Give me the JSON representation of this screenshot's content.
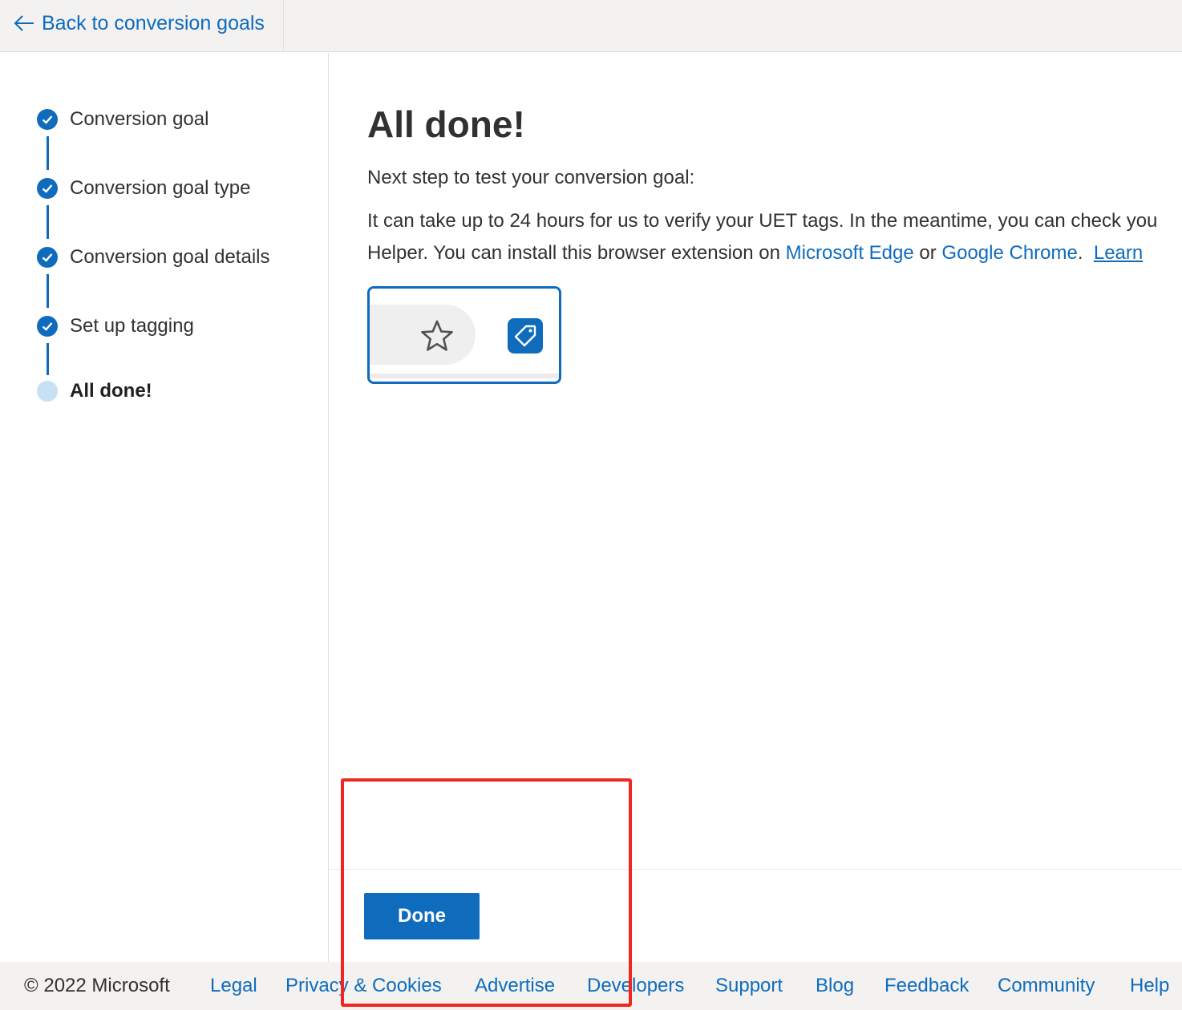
{
  "header": {
    "back_label": "Back to conversion goals"
  },
  "steps": [
    {
      "label": "Conversion goal",
      "state": "complete"
    },
    {
      "label": "Conversion goal type",
      "state": "complete"
    },
    {
      "label": "Conversion goal details",
      "state": "complete"
    },
    {
      "label": "Set up tagging",
      "state": "complete"
    },
    {
      "label": "All done!",
      "state": "current"
    }
  ],
  "main": {
    "title": "All done!",
    "subtitle": "Next step to test your conversion goal:",
    "para_line1": "It can take up to 24 hours for us to verify your UET tags. In the meantime, you can check you",
    "para_line2_prefix": "Helper. You can install this browser extension on ",
    "edge_link": "Microsoft Edge",
    "or_text": " or ",
    "chrome_link": "Google Chrome",
    "period": ".",
    "learn_link": "Learn ",
    "done_label": "Done"
  },
  "footer": {
    "copyright": "© 2022 Microsoft",
    "links": [
      "Legal",
      "Privacy & Cookies",
      "Advertise",
      "Developers",
      "Support",
      "Blog",
      "Feedback",
      "Community",
      "Help"
    ]
  },
  "colors": {
    "accent": "#0f6cbd",
    "highlight": "#f0271f",
    "current_step": "#c7e0f4"
  }
}
